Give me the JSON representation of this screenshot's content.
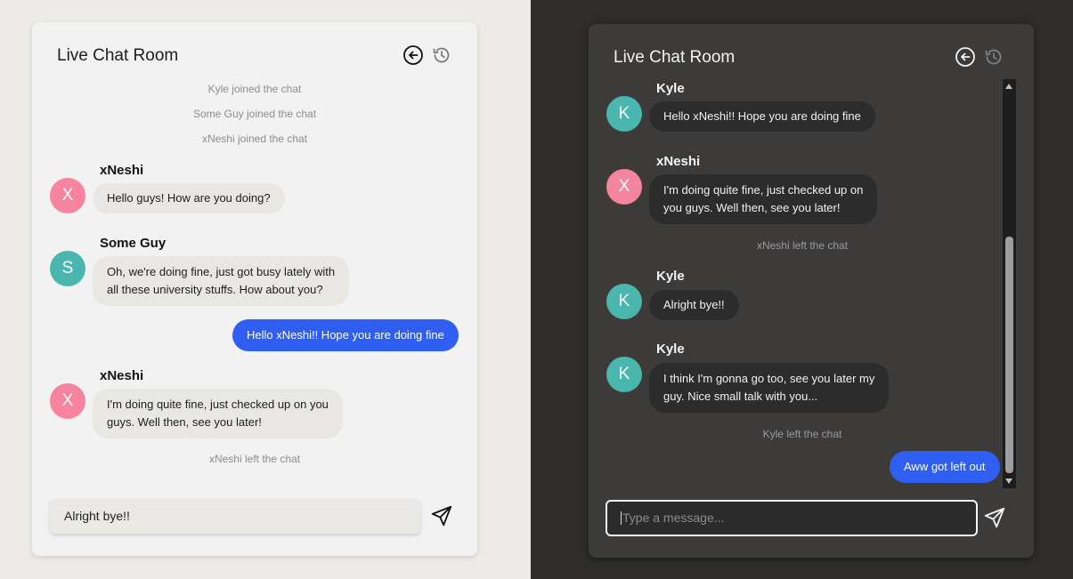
{
  "light": {
    "title": "Live Chat Room",
    "system_messages": [
      "Kyle joined the chat",
      "Some Guy joined the chat",
      "xNeshi joined the chat",
      "xNeshi left the chat"
    ],
    "messages": [
      {
        "sender": "xNeshi",
        "avatar": "X",
        "lines": [
          "Hello guys! How are you doing?"
        ]
      },
      {
        "sender": "Some Guy",
        "avatar": "S",
        "lines": [
          "Oh, we're doing fine, just got busy lately with",
          "all these university stuffs. How about you?"
        ]
      },
      {
        "own": true,
        "lines": [
          "Hello xNeshi!! Hope you are doing fine"
        ]
      },
      {
        "sender": "xNeshi",
        "avatar": "X",
        "lines": [
          "I'm doing quite fine, just checked up on you",
          "guys. Well then, see you later!"
        ]
      }
    ],
    "input_value": "Alright bye!!"
  },
  "dark": {
    "title": "Live Chat Room",
    "messages": [
      {
        "sender": "Kyle",
        "avatar": "K",
        "lines": [
          "Hello xNeshi!! Hope you are doing fine"
        ]
      },
      {
        "sender": "xNeshi",
        "avatar": "X",
        "lines": [
          "I'm doing quite fine, just checked up on",
          "you guys. Well then, see you later!"
        ]
      },
      {
        "sender": "Kyle",
        "avatar": "K",
        "lines": [
          "Alright bye!!"
        ]
      },
      {
        "sender": "Kyle",
        "avatar": "K",
        "lines": [
          "I think I'm gonna go too, see you later my",
          "guy. Nice small talk with you..."
        ]
      },
      {
        "own": true,
        "lines": [
          "Aww got left out"
        ]
      }
    ],
    "system_messages": [
      "xNeshi left the chat",
      "Kyle left the chat"
    ],
    "input_placeholder": "Type a message..."
  },
  "icons": {
    "back": "back-arrow-circle-icon",
    "history": "history-icon",
    "send": "send-icon"
  },
  "colors": {
    "own_bubble": "#2f5ef2",
    "avatar_pink": "#f7849f",
    "avatar_teal": "#49b7ae",
    "light_bg": "#ecebe7",
    "dark_bg": "#2e2d2b"
  }
}
